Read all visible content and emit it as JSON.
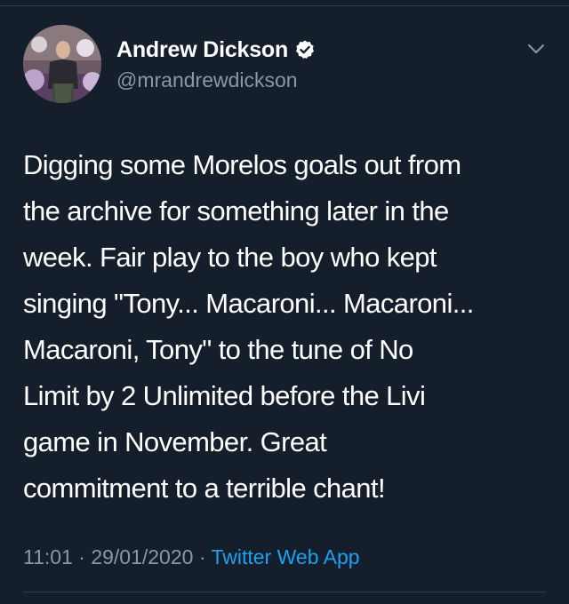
{
  "author": {
    "display_name": "Andrew Dickson",
    "handle": "@mrandrewdickson",
    "verified": true
  },
  "tweet": {
    "lines": [
      "Digging some Morelos goals out from",
      "the archive for something later in the",
      "week. Fair play to the boy who kept",
      "singing \"Tony... Macaroni... Macaroni...",
      "Macaroni, Tony\" to the tune of No",
      "Limit by 2 Unlimited before the Livi",
      "game in November. Great",
      "commitment to a terrible chant!"
    ]
  },
  "meta": {
    "time": "11:01",
    "separator": "·",
    "date": "29/01/2020",
    "source": "Twitter Web App"
  },
  "icons": {
    "verified": "verified-badge-icon",
    "menu": "chevron-down-icon"
  },
  "colors": {
    "background": "#151f2b",
    "text": "#ffffff",
    "secondary": "#8899a6",
    "link": "#1da1f2"
  }
}
